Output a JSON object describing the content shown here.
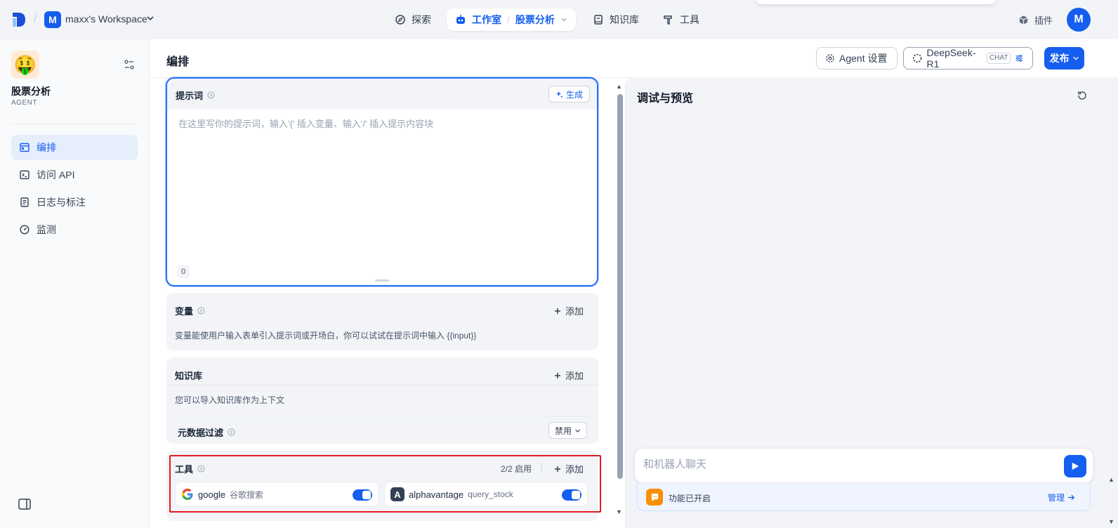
{
  "topbar": {
    "workspace_initial": "M",
    "workspace_name": "maxx's Workspace",
    "nav": {
      "explore": "探索",
      "studio": "工作室",
      "studio_app": "股票分析",
      "knowledge": "知识库",
      "tools": "工具"
    },
    "plugins": "插件",
    "user_initial": "M"
  },
  "sidebar": {
    "app_name": "股票分析",
    "app_type": "AGENT",
    "items": [
      {
        "label": "编排",
        "icon": "layout-icon",
        "active": true
      },
      {
        "label": "访问 API",
        "icon": "terminal-icon",
        "active": false
      },
      {
        "label": "日志与标注",
        "icon": "document-icon",
        "active": false
      },
      {
        "label": "监测",
        "icon": "gauge-icon",
        "active": false
      }
    ]
  },
  "main": {
    "title": "编排",
    "agent_settings_label": "Agent 设置",
    "model_name": "DeepSeek-R1",
    "model_tag": "CHAT",
    "publish_label": "发布"
  },
  "prompt": {
    "title": "提示词",
    "generate_label": "生成",
    "placeholder": "在这里写你的提示词，输入'{' 插入变量、输入'/' 插入提示内容块",
    "char_count": "0"
  },
  "variables": {
    "title": "变量",
    "add_label": "添加",
    "description": "变量能使用户输入表单引入提示词或开场白，你可以试试在提示词中输入 {{input}}"
  },
  "knowledge": {
    "title": "知识库",
    "add_label": "添加",
    "description": "您可以导入知识库作为上下文",
    "metadata_filter_label": "元数据过滤",
    "metadata_filter_value": "禁用"
  },
  "tools": {
    "title": "工具",
    "enabled_count": "2/2 启用",
    "add_label": "添加",
    "items": [
      {
        "name": "google",
        "description": "谷歌搜索",
        "icon": "google-icon",
        "enabled": true
      },
      {
        "name": "alphavantage",
        "description": "query_stock",
        "icon": "alphavantage-icon",
        "icon_letter": "A",
        "enabled": true
      }
    ]
  },
  "debug": {
    "title": "调试与预览",
    "chat_placeholder": "和机器人聊天",
    "feature_text": "功能已开启",
    "manage_label": "管理"
  },
  "colors": {
    "accent": "#155eef",
    "highlight_border": "#e31b23"
  }
}
